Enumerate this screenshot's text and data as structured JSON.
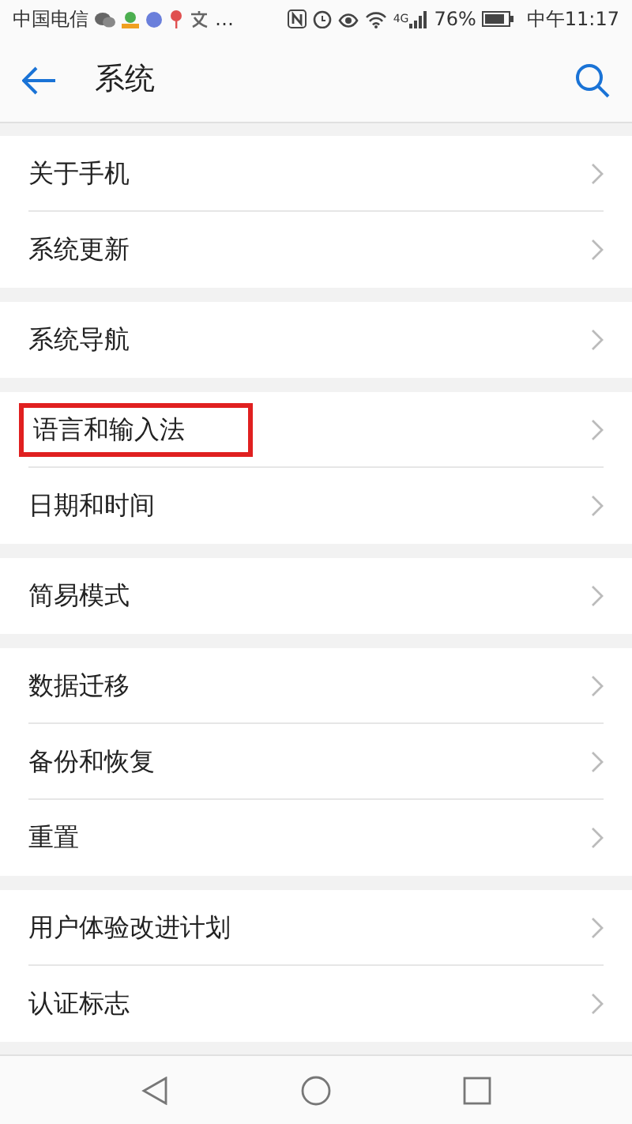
{
  "status_bar": {
    "carrier": "中国电信",
    "more": "…",
    "network": "4G",
    "battery": "76%",
    "time": "中午11:17"
  },
  "header": {
    "title": "系统"
  },
  "groups": [
    [
      {
        "label": "关于手机",
        "highlighted": false
      },
      {
        "label": "系统更新",
        "highlighted": false
      }
    ],
    [
      {
        "label": "系统导航",
        "highlighted": false
      }
    ],
    [
      {
        "label": "语言和输入法",
        "highlighted": true
      },
      {
        "label": "日期和时间",
        "highlighted": false
      }
    ],
    [
      {
        "label": "简易模式",
        "highlighted": false
      }
    ],
    [
      {
        "label": "数据迁移",
        "highlighted": false
      },
      {
        "label": "备份和恢复",
        "highlighted": false
      },
      {
        "label": "重置",
        "highlighted": false
      }
    ],
    [
      {
        "label": "用户体验改进计划",
        "highlighted": false
      },
      {
        "label": "认证标志",
        "highlighted": false
      }
    ]
  ]
}
